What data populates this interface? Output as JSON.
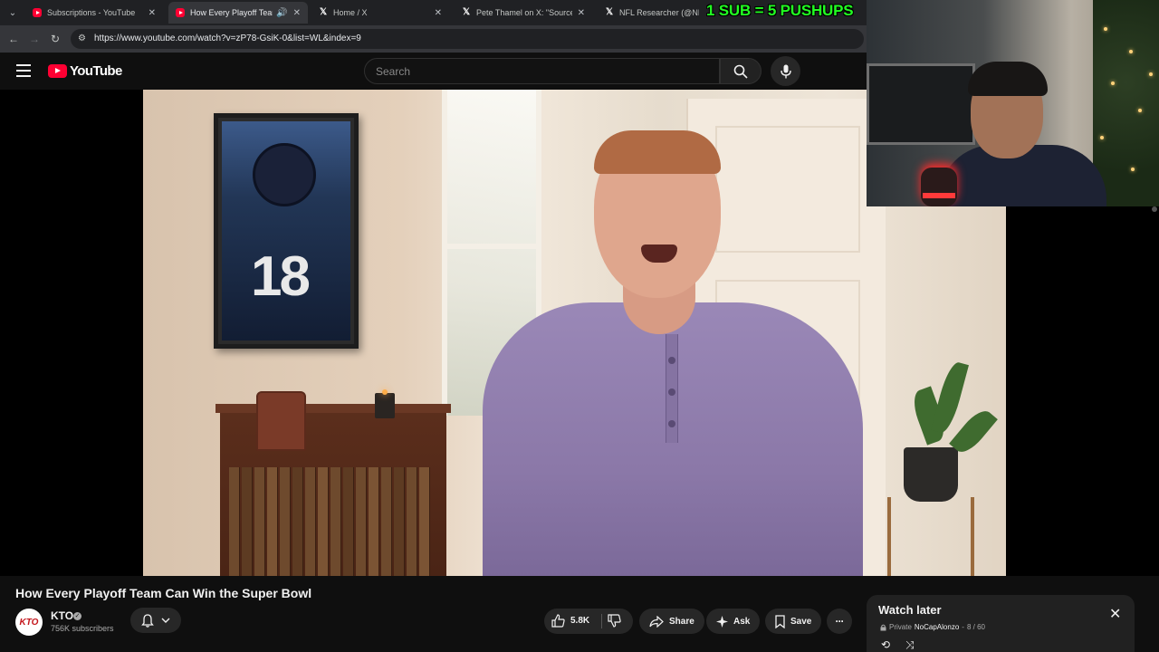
{
  "browser": {
    "tabs": [
      {
        "label": "Subscriptions - YouTube",
        "favicon": "youtube-icon",
        "active": false
      },
      {
        "label": "How Every Playoff Team Ca",
        "favicon": "youtube-icon",
        "active": true
      },
      {
        "label": "Home / X",
        "favicon": "x-icon",
        "active": false
      },
      {
        "label": "Pete Thamel on X: \"Sources: Oh",
        "favicon": "x-icon",
        "active": false
      },
      {
        "label": "NFL Researcher (@NFL_Rese",
        "favicon": "x-icon",
        "active": false
      }
    ],
    "url": "https://www.youtube.com/watch?v=zP78-GsiK-0&list=WL&index=9"
  },
  "header": {
    "logo_text": "YouTube",
    "search_placeholder": "Search"
  },
  "overlay": {
    "banner": "1 SUB = 5 PUSHUPS"
  },
  "video": {
    "title": "How Every Playoff Team Can Win the Super Bowl",
    "poster_number": "18",
    "channel": {
      "avatar_text": "KTO",
      "name": "KTO",
      "subscribers": "756K subscribers"
    },
    "actions": {
      "likes": "5.8K",
      "share": "Share",
      "ask": "Ask",
      "save": "Save"
    }
  },
  "playlist": {
    "title": "Watch later",
    "privacy": "Private",
    "owner": "NoCapAlonzo",
    "position": "8 / 60"
  },
  "colors": {
    "youtube_red": "#ff0033",
    "background": "#0f0f0f",
    "banner_green": "#22ff22"
  }
}
